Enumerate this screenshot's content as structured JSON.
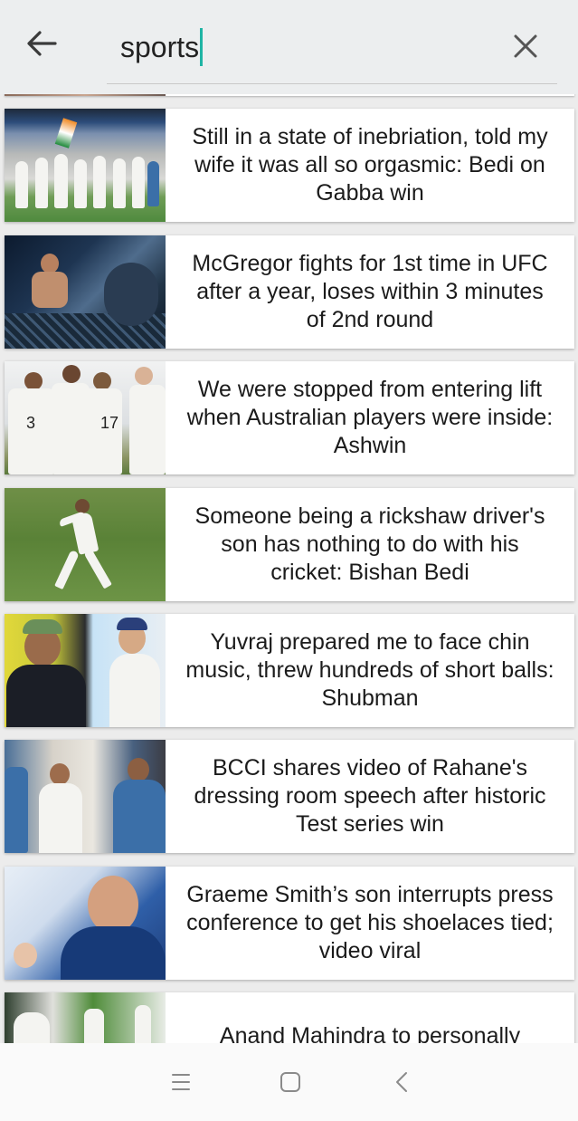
{
  "search": {
    "query": "sports"
  },
  "icons": {
    "back": "arrow-left-icon",
    "clear": "close-icon",
    "menu": "menu-lines-icon",
    "home": "home-square-icon",
    "nav_back": "chevron-left-icon"
  },
  "colors": {
    "caret": "#1fb4a4",
    "header_bg": "#eceeef",
    "card_bg": "#ffffff",
    "text": "#1b1b1b"
  },
  "results": [
    {
      "headline": "Still in a state of inebriation, told my wife it was all so orgasmic: Bedi on Gabba win"
    },
    {
      "headline": "McGregor fights for 1st time in UFC after a year, loses within 3 minutes of 2nd round"
    },
    {
      "headline": "We were stopped from entering lift when Australian players were inside: Ashwin"
    },
    {
      "headline": "Someone being a rickshaw driver's son has nothing to do with his cricket: Bishan Bedi"
    },
    {
      "headline": "Yuvraj prepared me to face chin music, threw hundreds of short balls: Shubman"
    },
    {
      "headline": "BCCI shares video of Rahane's dressing room speech after historic Test series win"
    },
    {
      "headline": "Graeme Smith’s son interrupts press conference to get his shoelaces tied; video viral"
    },
    {
      "headline": "Anand Mahindra to personally"
    }
  ]
}
